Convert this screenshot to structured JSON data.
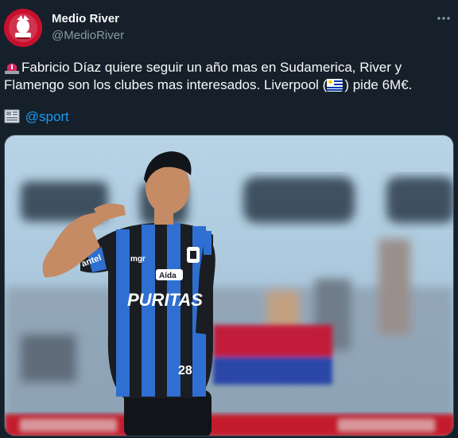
{
  "author": {
    "name": "Medio River",
    "handle": "@MedioRiver"
  },
  "tweet": {
    "line1": "Fabricio Díaz quiere seguir un año mas en Sudamerica, River y",
    "line2_a": "Flamengo son los clubes mas interesados. Liverpool (",
    "line2_b": ") pide 6M€.",
    "source_mention": "@sport"
  },
  "icons": {
    "more": "more-options-icon",
    "siren": "rotating-light-emoji",
    "flag": "uruguay-flag-emoji",
    "news": "newspaper-emoji"
  },
  "photo": {
    "shirt_sponsor": "PURITAS",
    "chest_logo": "Aída",
    "sleeve_text": "antel",
    "brand_text": "mgr",
    "number": "28"
  },
  "colors": {
    "background": "#15202b",
    "text": "#f7f9f9",
    "muted": "#8b98a5",
    "link": "#1d9bf0",
    "avatar_red": "#c8102e"
  }
}
